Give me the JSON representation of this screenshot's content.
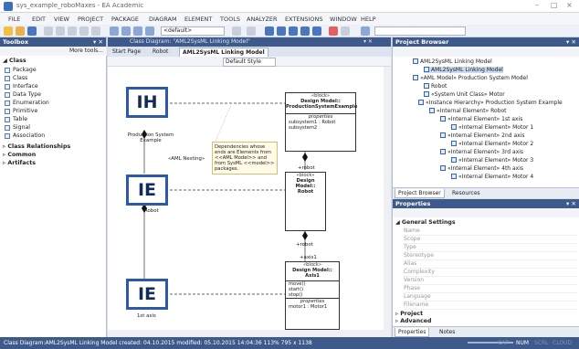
{
  "window": {
    "title": "sys_example_roboMaxes - EA Academic",
    "controls": [
      "–",
      "□",
      "×"
    ]
  },
  "menu": [
    "FILE",
    "EDIT",
    "VIEW",
    "PROJECT",
    "PACKAGE",
    "DIAGRAM",
    "ELEMENT",
    "TOOLS",
    "ANALYZER",
    "EXTENSIONS",
    "WINDOW",
    "HELP"
  ],
  "toolbar": {
    "perspective": "<default>"
  },
  "toolbox": {
    "title": "Toolbox",
    "more_tools": "More tools...",
    "group_class": "Class",
    "items": [
      "Package",
      "Class",
      "Interface",
      "Data Type",
      "Enumeration",
      "Primitive",
      "Table",
      "Signal",
      "Association"
    ],
    "groups": [
      "Class Relationships",
      "Common",
      "Artifacts"
    ]
  },
  "diagram": {
    "caption": "Class Diagram: \"AML2SysML Linking Model\"",
    "tabs": [
      "Start Page",
      "Robot",
      "AML2SysML Linking Model"
    ],
    "style_select": "Default Style",
    "blocks": {
      "pse": {
        "stereo": "«block»",
        "name1": "Design Model::",
        "name2": "ProductionSystemExample",
        "section": "properties",
        "rows": [
          "subsystem1 : Robot",
          "subsystem2"
        ]
      },
      "robot": {
        "stereo": "«block»",
        "name1": "Design Model::",
        "name2": "Robot"
      },
      "axis": {
        "stereo": "«block»",
        "name1": "Design Model::",
        "name2": "Axis1",
        "ops": [
          "move()",
          "start()",
          "stop()"
        ],
        "section": "properties",
        "rows": [
          "motor1 : Motor1"
        ]
      }
    },
    "icons": {
      "ih": "IH",
      "ie1": "IE",
      "ie2": "IE"
    },
    "labels": {
      "pse": "Production System Example",
      "aml": "«AML Nesting»",
      "robot": "Robot",
      "axis": "1st axis",
      "role_robot1": "+robot",
      "role_robot2": "+robot",
      "role_axis": "+axis1"
    },
    "note": "Dependencies whose ends are Elements from <<AML Model>> and from SysML <<model>> packages."
  },
  "browser": {
    "title": "Project Browser",
    "items": [
      "AML2SysML Linking Model",
      "AML2SysML Linking Model",
      "«AML Model» Production System Model",
      "Robot",
      "«System Unit Class» Motor",
      "«Instance Hierarchy» Production System Example",
      "«Internal Element» Robot",
      "«Internal Element» 1st axis",
      "«Internal Element» Motor 1",
      "«Internal Element» 2nd axis",
      "«Internal Element» Motor 2",
      "«Internal Element» 3rd axis",
      "«Internal Element» Motor 3",
      "«Internal Element» 4th axis",
      "«Internal Element» Motor 4"
    ],
    "tabs": [
      "Project Browser",
      "Resources"
    ]
  },
  "properties": {
    "title": "Properties",
    "general": "General Settings",
    "rows": [
      "Name",
      "Scope",
      "Type",
      "Stereotype",
      "Alias",
      "Complexity",
      "Version",
      "Phase",
      "Language",
      "Filename"
    ],
    "groups": [
      "Project",
      "Advanced"
    ],
    "tabs": [
      "Properties",
      "Notes"
    ]
  },
  "status": {
    "text": "Class Diagram:AML2SysML Linking Model   created: 04.10.2015  modified: 05.10.2015 14:04:36   113%   795 x 1138",
    "right": [
      "CAP",
      "NUM",
      "SCRL",
      "CLOUD"
    ]
  }
}
